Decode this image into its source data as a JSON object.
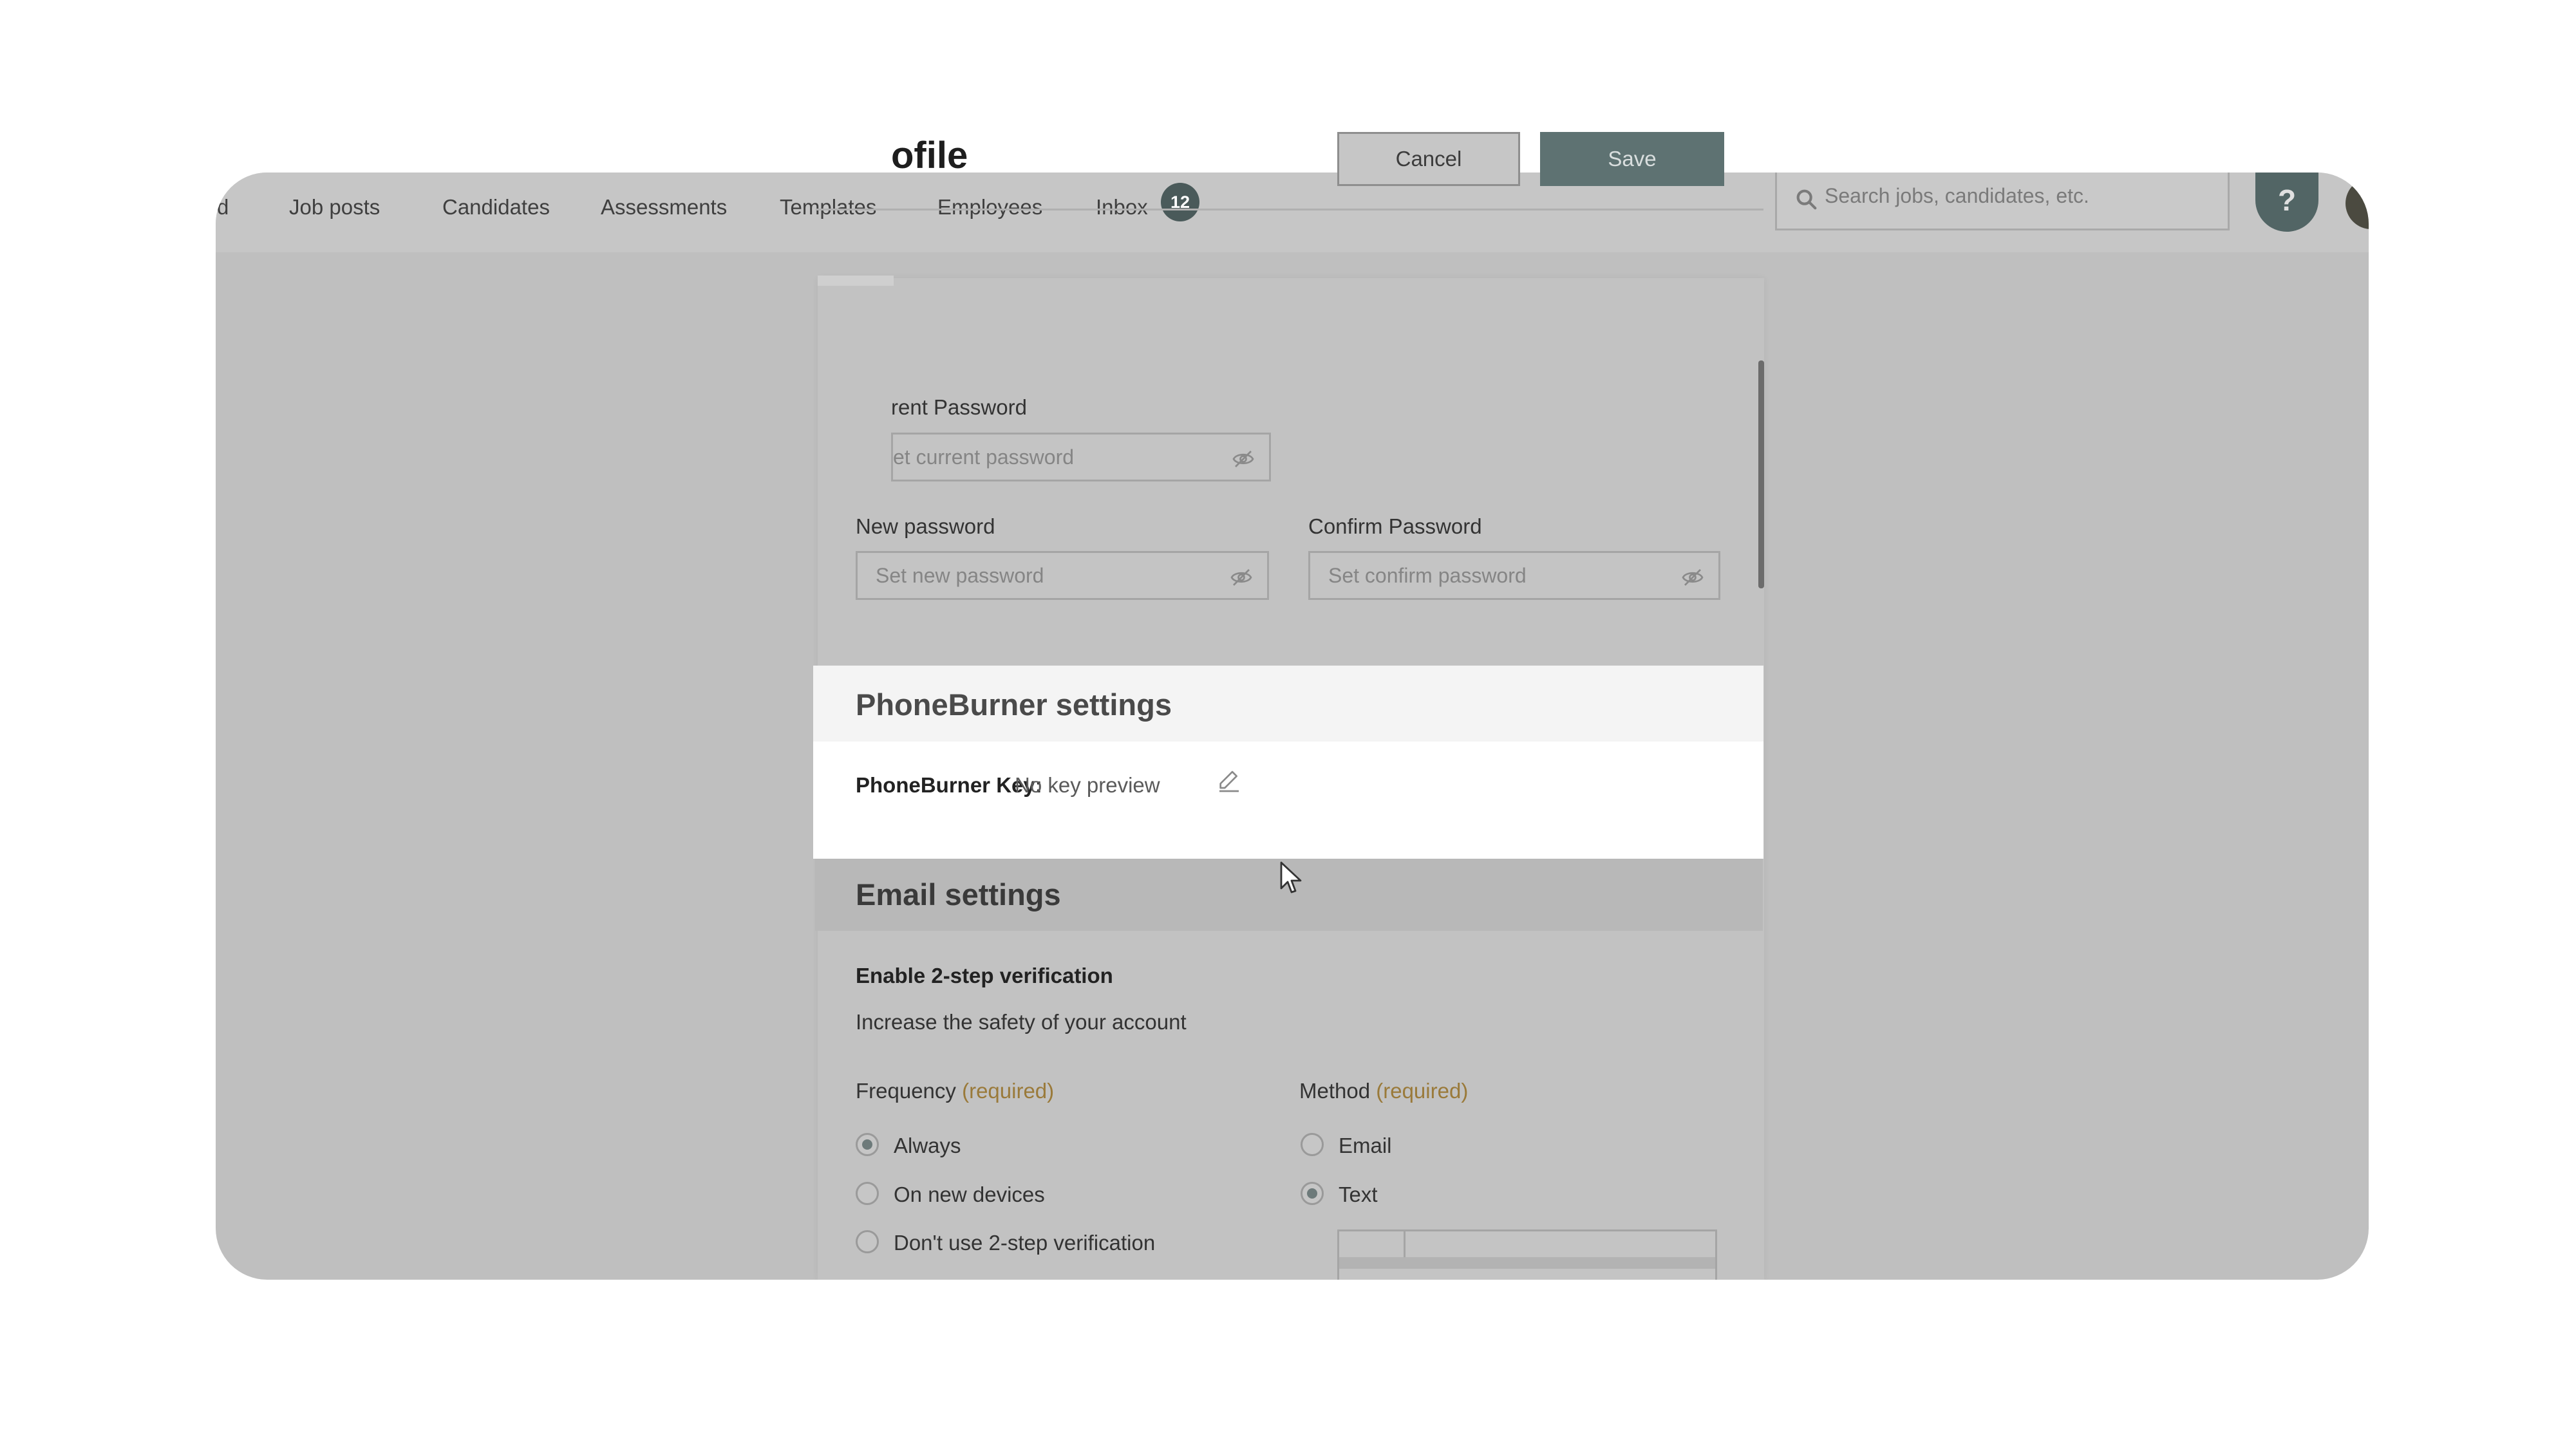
{
  "nav": {
    "items": [
      {
        "label": "d"
      },
      {
        "label": "Job posts"
      },
      {
        "label": "Candidates"
      },
      {
        "label": "Assessments"
      },
      {
        "label": "Templates"
      },
      {
        "label": "Employees"
      },
      {
        "label": "Inbox"
      }
    ],
    "inbox_count": "12",
    "search_placeholder": "Search jobs, candidates, etc.",
    "help_label": "?"
  },
  "dialog": {
    "title": "ofile",
    "cancel_label": "Cancel",
    "save_label": "Save",
    "current_password": {
      "label": "rent Password",
      "placeholder": "et current password"
    },
    "new_password": {
      "label": "New password",
      "placeholder": "Set new password"
    },
    "confirm_password": {
      "label": "Confirm Password",
      "placeholder": "Set confirm password"
    }
  },
  "phoneburner": {
    "title": "PhoneBurner settings",
    "key_label": "PhoneBurner Key:",
    "key_value": "No key preview"
  },
  "email_settings": {
    "title": "Email settings",
    "two_step_label": "Enable 2-step verification",
    "two_step_desc": "Increase the safety of your account",
    "frequency_label": "Frequency",
    "method_label": "Method",
    "required_text": "(required)",
    "frequency_options": [
      {
        "label": "Always",
        "checked": true
      },
      {
        "label": "On new devices",
        "checked": false
      },
      {
        "label": "Don't use 2-step verification",
        "checked": false
      }
    ],
    "method_options": [
      {
        "label": "Email",
        "checked": false
      },
      {
        "label": "Text",
        "checked": true
      }
    ]
  }
}
